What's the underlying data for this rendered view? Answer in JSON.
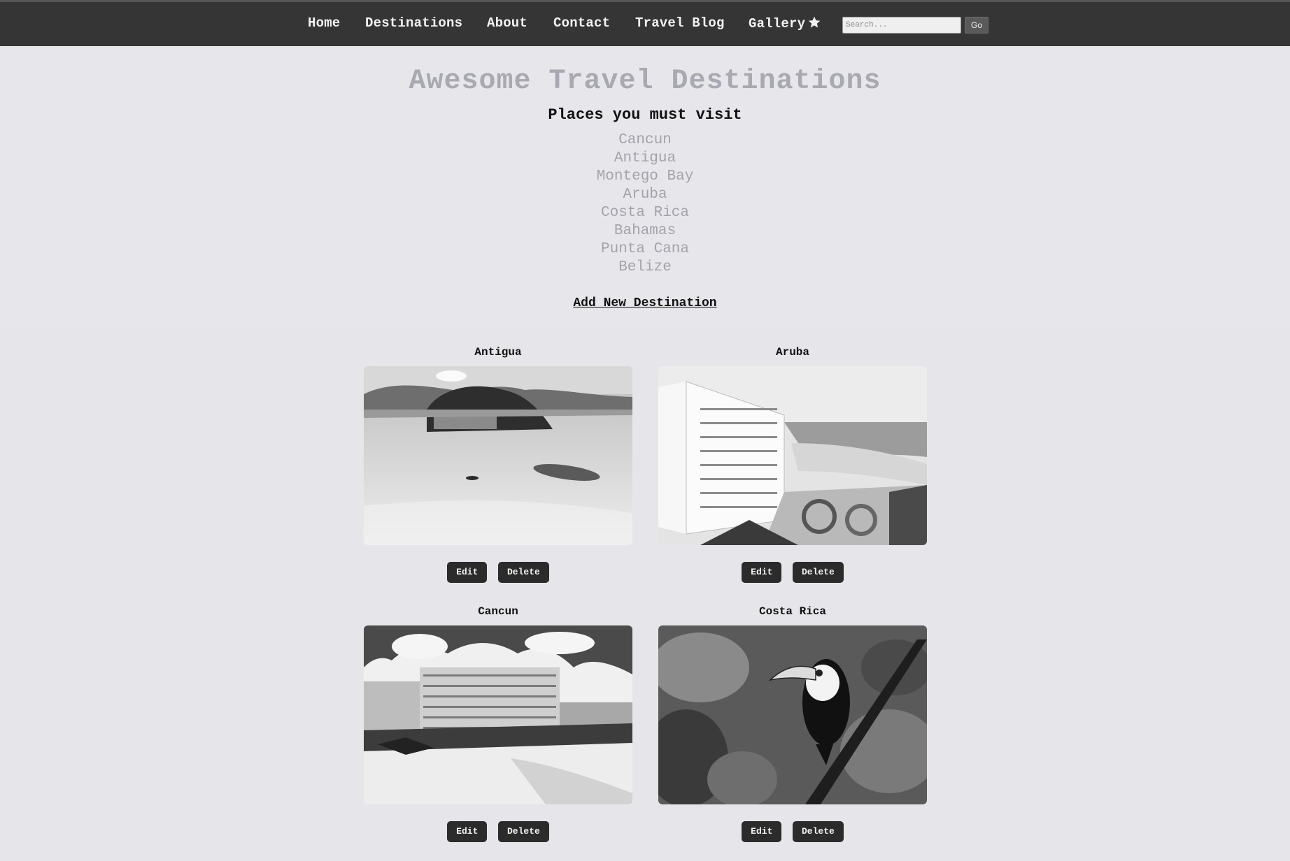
{
  "nav": {
    "items": [
      {
        "label": "Home"
      },
      {
        "label": "Destinations"
      },
      {
        "label": "About"
      },
      {
        "label": "Contact"
      },
      {
        "label": "Travel Blog"
      },
      {
        "label": "Gallery"
      }
    ],
    "gallery_icon": "star-icon",
    "search_placeholder": "Search...",
    "go_label": "Go"
  },
  "hero": {
    "title": "Awesome Travel Destinations",
    "subtitle": "Places you must visit",
    "places": [
      "Cancun",
      "Antigua",
      "Montego Bay",
      "Aruba",
      "Costa Rica",
      "Bahamas",
      "Punta Cana",
      "Belize"
    ],
    "add_label": "Add New Destination"
  },
  "cards": [
    {
      "title": "Antigua",
      "edit_label": "Edit",
      "delete_label": "Delete",
      "image": "island-photo"
    },
    {
      "title": "Aruba",
      "edit_label": "Edit",
      "delete_label": "Delete",
      "image": "resort-beach-photo"
    },
    {
      "title": "Cancun",
      "edit_label": "Edit",
      "delete_label": "Delete",
      "image": "hotel-photo"
    },
    {
      "title": "Costa Rica",
      "edit_label": "Edit",
      "delete_label": "Delete",
      "image": "toucan-photo"
    }
  ],
  "colors": {
    "navbar": "#353535",
    "background": "#e6e6ea",
    "title": "#a9a9b2",
    "button": "#2b2b2b"
  }
}
